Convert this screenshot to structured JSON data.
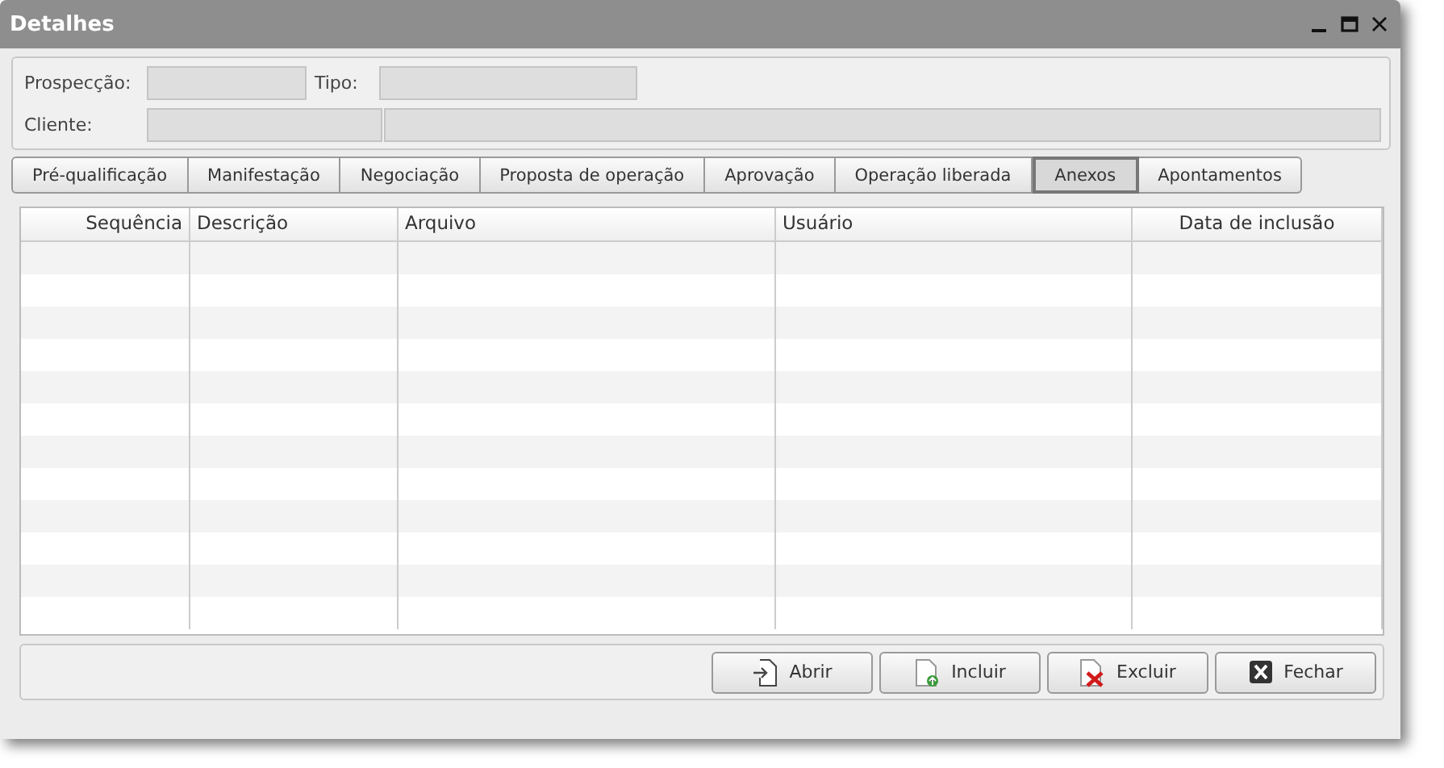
{
  "window": {
    "title": "Detalhes"
  },
  "fields": {
    "prospeccao_label": "Prospecção:",
    "tipo_label": "Tipo:",
    "cliente_label": "Cliente:"
  },
  "tabs": [
    {
      "label": "Pré-qualificação",
      "selected": false
    },
    {
      "label": "Manifestação",
      "selected": false
    },
    {
      "label": "Negociação",
      "selected": false
    },
    {
      "label": "Proposta de operação",
      "selected": false
    },
    {
      "label": "Aprovação",
      "selected": false
    },
    {
      "label": "Operação liberada",
      "selected": false
    },
    {
      "label": "Anexos",
      "selected": true
    },
    {
      "label": "Apontamentos",
      "selected": false
    }
  ],
  "table": {
    "columns": [
      "Sequência",
      "Descrição",
      "Arquivo",
      "Usuário",
      "Data de inclusão"
    ]
  },
  "buttons": [
    {
      "label": "Abrir",
      "kind": "open"
    },
    {
      "label": "Incluir",
      "kind": "add"
    },
    {
      "label": "Excluir",
      "kind": "delete"
    },
    {
      "label": "Fechar",
      "kind": "close"
    }
  ]
}
